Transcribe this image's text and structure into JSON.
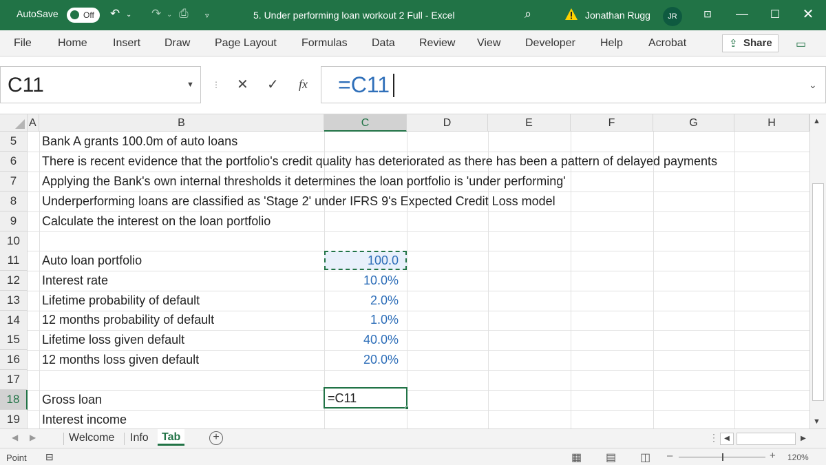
{
  "titlebar": {
    "autosave_label": "AutoSave",
    "autosave_state": "Off",
    "document_title": "5. Under performing loan workout 2 Full  -  Excel",
    "user_name": "Jonathan Rugg",
    "user_initials": "JR"
  },
  "ribbon": {
    "tabs": [
      "File",
      "Home",
      "Insert",
      "Draw",
      "Page Layout",
      "Formulas",
      "Data",
      "Review",
      "View",
      "Developer",
      "Help",
      "Acrobat"
    ],
    "share_label": "Share"
  },
  "formula_bar": {
    "name_box": "C11",
    "formula": "=C11"
  },
  "grid": {
    "columns": [
      "A",
      "B",
      "C",
      "D",
      "E",
      "F",
      "G",
      "H"
    ],
    "rows": [
      "5",
      "6",
      "7",
      "8",
      "9",
      "10",
      "11",
      "12",
      "13",
      "14",
      "15",
      "16",
      "17",
      "18",
      "19"
    ],
    "selected_column": "C",
    "selected_row": "18",
    "text_rows": [
      "Bank A grants 100.0m of auto loans",
      "There is recent evidence that the portfolio's credit quality has deteriorated as there has been a pattern of delayed payments",
      "Applying the Bank's own internal thresholds it determines the loan portfolio is 'under performing'",
      "Underperforming loans are classified as 'Stage 2' under IFRS 9's Expected Credit Loss model",
      "Calculate the interest on the loan portfolio"
    ],
    "inputs": [
      {
        "label": "Auto loan portfolio",
        "value": "100.0"
      },
      {
        "label": "Interest rate",
        "value": "10.0%"
      },
      {
        "label": "Lifetime probability of default",
        "value": "2.0%"
      },
      {
        "label": "12 months probability of default",
        "value": "1.0%"
      },
      {
        "label": "Lifetime loss given default",
        "value": "40.0%"
      },
      {
        "label": "12 months loss given default",
        "value": "20.0%"
      }
    ],
    "outputs": [
      {
        "label": "Gross loan",
        "value": "=C11"
      },
      {
        "label": "Interest income",
        "value": ""
      }
    ]
  },
  "sheets": {
    "tabs": [
      "Welcome",
      "Info",
      "Tab"
    ],
    "active": "Tab"
  },
  "statusbar": {
    "mode": "Point",
    "zoom": "120%"
  },
  "colors": {
    "accent": "#217346",
    "input_blue": "#2f6fb9"
  }
}
